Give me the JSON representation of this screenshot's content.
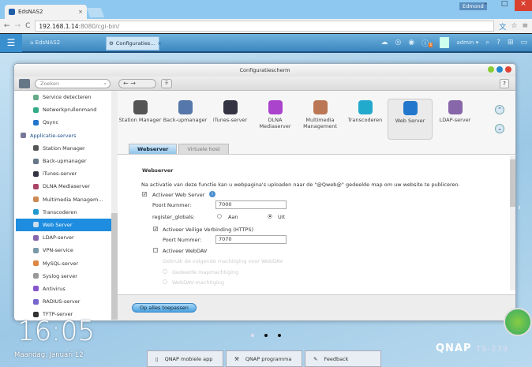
{
  "browser": {
    "tab_title": "EdsNAS2",
    "user": "Edmond",
    "url_host": "192.168.1.14",
    "url_path": ":8080/cgi-bin/"
  },
  "qnap_bar": {
    "home": "EdsNAS2",
    "app_tab": "Configuraties...",
    "user": "admin"
  },
  "window": {
    "title": "Configuratiescherm",
    "search_placeholder": "Zoeken",
    "help": "?"
  },
  "sidebar": {
    "items": [
      {
        "label": "Service detecteren",
        "color": "#6a8"
      },
      {
        "label": "Netwerkprullenmand",
        "color": "#3a8"
      },
      {
        "label": "Qsync",
        "color": "#27c"
      },
      {
        "label": "Applicatie-servers",
        "head": true,
        "color": "#779"
      },
      {
        "label": "Station Manager",
        "color": "#555"
      },
      {
        "label": "Back-upmanager",
        "color": "#678"
      },
      {
        "label": "iTunes-server",
        "color": "#334"
      },
      {
        "label": "DLNA Mediaserver",
        "color": "#a46"
      },
      {
        "label": "Multimedia Managem...",
        "color": "#c85"
      },
      {
        "label": "Transcoderen",
        "color": "#29c"
      },
      {
        "label": "Web Server",
        "selected": true,
        "color": "#cde"
      },
      {
        "label": "LDAP-server",
        "color": "#86a"
      },
      {
        "label": "VPN-service",
        "color": "#79a"
      },
      {
        "label": "MySQL-server",
        "color": "#d84"
      },
      {
        "label": "Syslog server",
        "color": "#999"
      },
      {
        "label": "Antivirus",
        "color": "#85c"
      },
      {
        "label": "RADIUS-server",
        "color": "#76c"
      },
      {
        "label": "TFTP-server",
        "color": "#333"
      }
    ]
  },
  "apps": [
    {
      "label": "Station Manager",
      "color": "#555"
    },
    {
      "label": "Back-upmanager",
      "color": "#57a"
    },
    {
      "label": "iTunes-server",
      "color": "#334"
    },
    {
      "label": "DLNA Mediaserver",
      "color": "#a4c"
    },
    {
      "label": "Multimedia Management",
      "color": "#b75"
    },
    {
      "label": "Transcoderen",
      "color": "#2ac"
    },
    {
      "label": "Web Server",
      "color": "#27c",
      "selected": true
    },
    {
      "label": "LDAP-server",
      "color": "#86a"
    }
  ],
  "tabs": [
    "Webserver",
    "Virtuele host"
  ],
  "form": {
    "section_title": "Webserver",
    "description": "Na activatie van deze functie kan u webpagina's uploaden naar de \"@Qweb@\" gedeelde map om uw website te publiceren.",
    "enable_web_server": {
      "label": "Activeer Web Server",
      "checked": true
    },
    "port_label": "Poort Nummer:",
    "port_value": "7000",
    "register_globals_label": "register_globals:",
    "radio_on": "Aan",
    "radio_off": "Uit",
    "register_globals": "Uit",
    "https": {
      "label": "Activeer Veilige Verbinding (HTTPS)",
      "checked": true
    },
    "https_port_label": "Poort Nummer:",
    "https_port_value": "7070",
    "webdav": {
      "label": "Activeer WebDAV",
      "checked": false
    },
    "webdav_hint": "Gebruik de volgende machtiging voor WebDAV",
    "webdav_opt1": "Gedeelde mapmachtiging",
    "webdav_opt2": "WebDAV-machtiging",
    "apply": "Op alles toepassen"
  },
  "desktop": {
    "time": "16:05",
    "date": "Maandag, Januari 12",
    "logo": "QNAP",
    "model": "TS-239",
    "taskbar": [
      "QNAP mobiele app",
      "QNAP programma",
      "Feedback"
    ]
  }
}
